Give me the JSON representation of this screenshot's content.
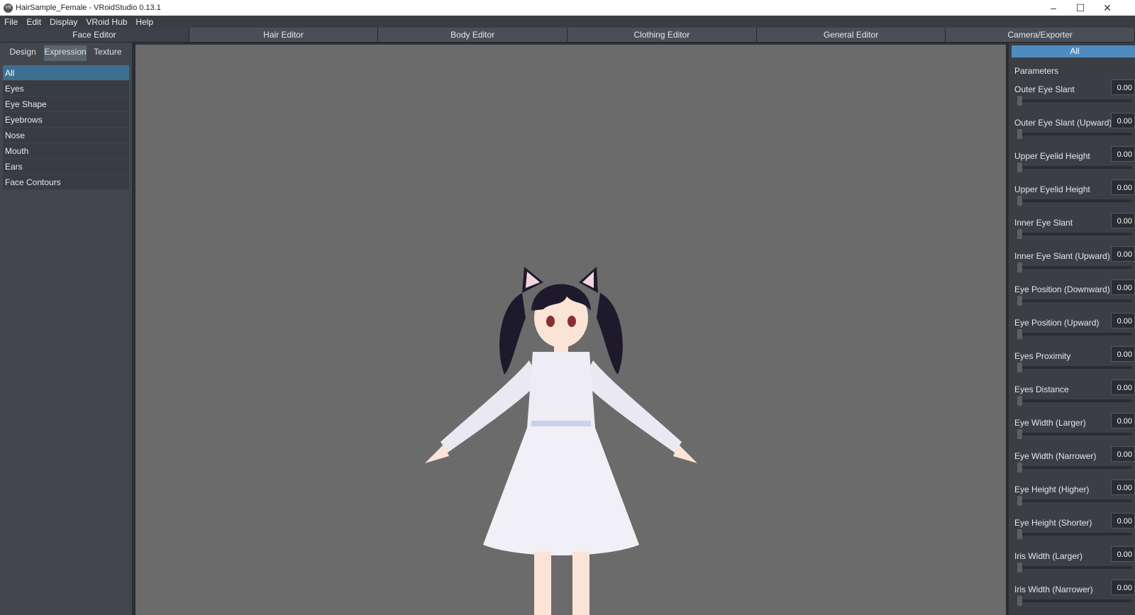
{
  "window": {
    "title": "HairSample_Female - VRoidStudio 0.13.1",
    "app_icon_text": "VR"
  },
  "menu": [
    "File",
    "Edit",
    "Display",
    "VRoid Hub",
    "Help"
  ],
  "editor_tabs": [
    "Face Editor",
    "Hair Editor",
    "Body Editor",
    "Clothing Editor",
    "General Editor",
    "Camera/Exporter"
  ],
  "active_editor": "Face Editor",
  "sub_tabs": [
    "Design",
    "Expression",
    "Texture"
  ],
  "active_sub_tab": "Expression",
  "categories": [
    "All",
    "Eyes",
    "Eye Shape",
    "Eyebrows",
    "Nose",
    "Mouth",
    "Ears",
    "Face Contours"
  ],
  "selected_category": "All",
  "right_panel": {
    "header": "All",
    "params_title": "Parameters",
    "params": [
      {
        "label": "Outer Eye Slant",
        "value": "0.00"
      },
      {
        "label": "Outer Eye Slant (Upward)",
        "value": "0.00"
      },
      {
        "label": "Upper Eyelid Height",
        "value": "0.00"
      },
      {
        "label": "Upper Eyelid Height",
        "value": "0.00"
      },
      {
        "label": "Inner Eye Slant",
        "value": "0.00"
      },
      {
        "label": "Inner Eye Slant (Upward)",
        "value": "0.00"
      },
      {
        "label": "Eye Position (Downward)",
        "value": "0.00"
      },
      {
        "label": "Eye Position (Upward)",
        "value": "0.00"
      },
      {
        "label": "Eyes Proximity",
        "value": "0.00"
      },
      {
        "label": "Eyes Distance",
        "value": "0.00"
      },
      {
        "label": "Eye Width (Larger)",
        "value": "0.00"
      },
      {
        "label": "Eye Width (Narrower)",
        "value": "0.00"
      },
      {
        "label": "Eye Height (Higher)",
        "value": "0.00"
      },
      {
        "label": "Eye Height (Shorter)",
        "value": "0.00"
      },
      {
        "label": "Iris Width (Larger)",
        "value": "0.00"
      },
      {
        "label": "Iris Width (Narrower)",
        "value": "0.00"
      }
    ]
  },
  "colors": {
    "accent": "#4d8bc0",
    "selected_category": "#3d6f93",
    "viewport_bg": "#6b6b6b"
  }
}
